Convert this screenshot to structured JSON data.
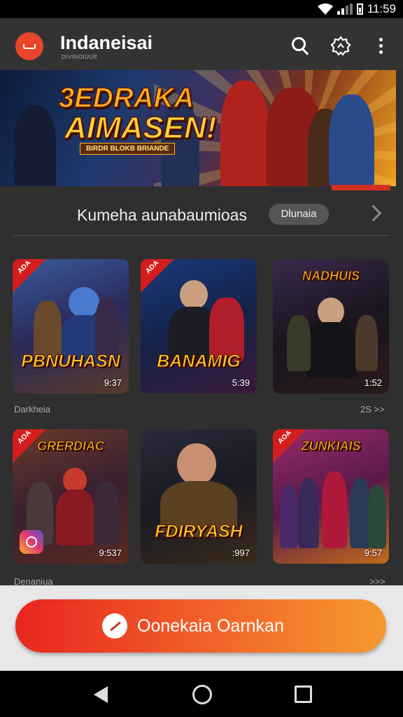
{
  "status_bar": {
    "time": "11:59"
  },
  "app_bar": {
    "title": "Indaneisai",
    "subtitle": "DIVINOIUUE"
  },
  "banner": {
    "title_line1": "3EDRAKA",
    "title_line2": "AIMASEN!",
    "tagline": "BIRDR BLOKB BRIANDE"
  },
  "featured": {
    "title": "Kumeha aunabaumioas",
    "button_label": "Dlunaia"
  },
  "rows": [
    {
      "label": "Darkheia",
      "aux": "2S >>",
      "cards": [
        {
          "badge": "ADA",
          "title": "PBNUHASN",
          "duration": "9:37"
        },
        {
          "badge": "ADA",
          "title": "BANAMIG",
          "duration": "5:39"
        },
        {
          "badge": "",
          "title": "NADHUIS",
          "duration": "1:52"
        }
      ]
    },
    {
      "label": "Denaniua",
      "aux": ">>>",
      "cards": [
        {
          "badge": "AOA",
          "title": "GRERDIAC",
          "duration": "9:537"
        },
        {
          "badge": "",
          "title": "FDIRYASH",
          "duration": ":997"
        },
        {
          "badge": "AOA",
          "title": "ZUNKIAIS",
          "duration": "9:57"
        }
      ]
    }
  ],
  "cta": {
    "label": "Oonekaia Oarnkan"
  },
  "colors": {
    "accent": "#e8452a",
    "cta_start": "#e8251f",
    "cta_end": "#f59a2e"
  }
}
